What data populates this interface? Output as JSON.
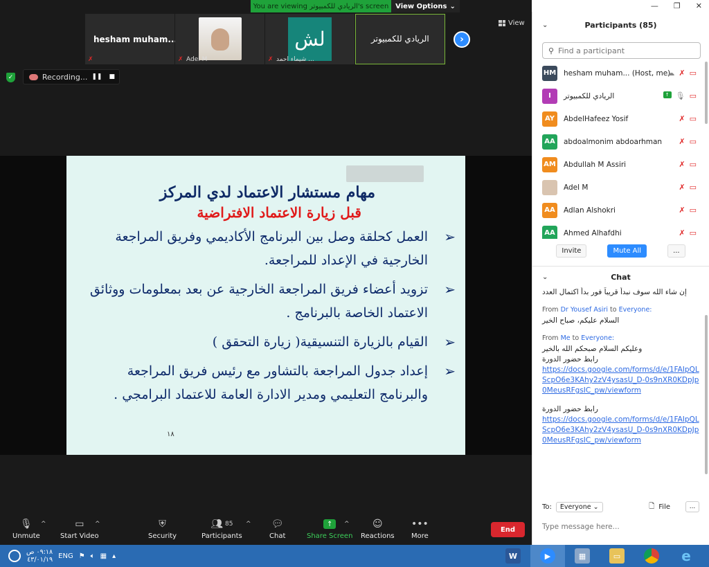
{
  "viewing_bar": {
    "text": "You are viewing الريادي للكمبيوتر's screen",
    "options_label": "View Options"
  },
  "view_label": "View",
  "thumbnails": [
    {
      "name": "hesham  muham..."
    },
    {
      "caption": "Adel M"
    },
    {
      "tile_text": "لش",
      "caption": "شيماء احمد ..."
    },
    {
      "name": "الريادي للكمبيوتر"
    }
  ],
  "recording_label": "Recording...",
  "slide": {
    "title1": "مهام مستشار الاعتماد لدي المركز",
    "title2": "قبل زيارة الاعتماد الافتراضية",
    "bullets": [
      "العمل كحلقة وصل بين البرنامج الأكاديمي وفريق المراجعة الخارجية في الإعداد للمراجعة.",
      "تزويد أعضاء فريق المراجعة الخارجية عن بعد بمعلومات ووثائق الاعتماد الخاصة بالبرنامج .",
      "القيام بالزيارة التنسيقية( زيارة التحقق )",
      "إعداد جدول المراجعة بالتشاور مع رئيس فريق المراجعة والبرنامج التعليمي ومدير الادارة العامة للاعتماد البرامجي ."
    ],
    "page_number": "١٨"
  },
  "toolbar": {
    "unmute": "Unmute",
    "start_video": "Start Video",
    "security": "Security",
    "participants": "Participants",
    "participants_count": "85",
    "chat": "Chat",
    "share_screen": "Share Screen",
    "reactions": "Reactions",
    "more": "More",
    "end": "End"
  },
  "participants_panel": {
    "title": "Participants (85)",
    "search_placeholder": "Find a participant",
    "items": [
      {
        "initials": "HM",
        "name": "hesham muham...",
        "tag": "(Host, me)",
        "color": "#3b4a5c"
      },
      {
        "initials": "I",
        "name": "الريادي للكمبيوتر",
        "color": "#b23cb5"
      },
      {
        "initials": "AY",
        "name": "AbdelHafeez Yosif",
        "color": "#f08c1e"
      },
      {
        "initials": "AA",
        "name": "abdoalmonim abdoarhman",
        "color": "#22a55a"
      },
      {
        "initials": "AM",
        "name": "Abdullah M Assiri",
        "color": "#f08c1e"
      },
      {
        "initials": "",
        "name": "Adel M",
        "color": "#d9c4b0"
      },
      {
        "initials": "AA",
        "name": "Adlan Alshokri",
        "color": "#f08c1e"
      },
      {
        "initials": "AA",
        "name": "Ahmed Alhafdhi",
        "color": "#22a55a"
      }
    ],
    "invite": "Invite",
    "mute_all": "Mute All",
    "more": "..."
  },
  "chat_panel": {
    "title": "Chat",
    "messages": [
      {
        "text": "إن شاء الله سوف نبدأ قريباً فور بدأ اكتمال العدد"
      },
      {
        "from_label": "From",
        "from": "Dr Yousef Asiri",
        "to_label": "to",
        "to": "Everyone:",
        "text": "السلام عليكم، صباح الخير"
      },
      {
        "from_label": "From",
        "from": "Me",
        "to_label": "to",
        "to": "Everyone:",
        "text": "وعليكم السلام صبحكم الله بالخير",
        "text2": "رابط حضور الدورة",
        "link": "https://docs.google.com/forms/d/e/1FAIpQLScpO6e3KAhy2zV4ysasU_D-0s9nXR0KDpJp0MeusRFgsIC_pw/viewform"
      },
      {
        "text2": "رابط حضور الدورة",
        "link": "https://docs.google.com/forms/d/e/1FAIpQLScpO6e3KAhy2zV4ysasU_D-0s9nXR0KDpJp0MeusRFgsIC_pw/viewform"
      }
    ],
    "to_label": "To:",
    "to_value": "Everyone",
    "file_label": "File",
    "more": "...",
    "input_placeholder": "Type message here..."
  },
  "taskbar": {
    "time": "٠٩:١٨ ص",
    "date": "٤٣/٠١/١٩",
    "lang": "ENG"
  }
}
